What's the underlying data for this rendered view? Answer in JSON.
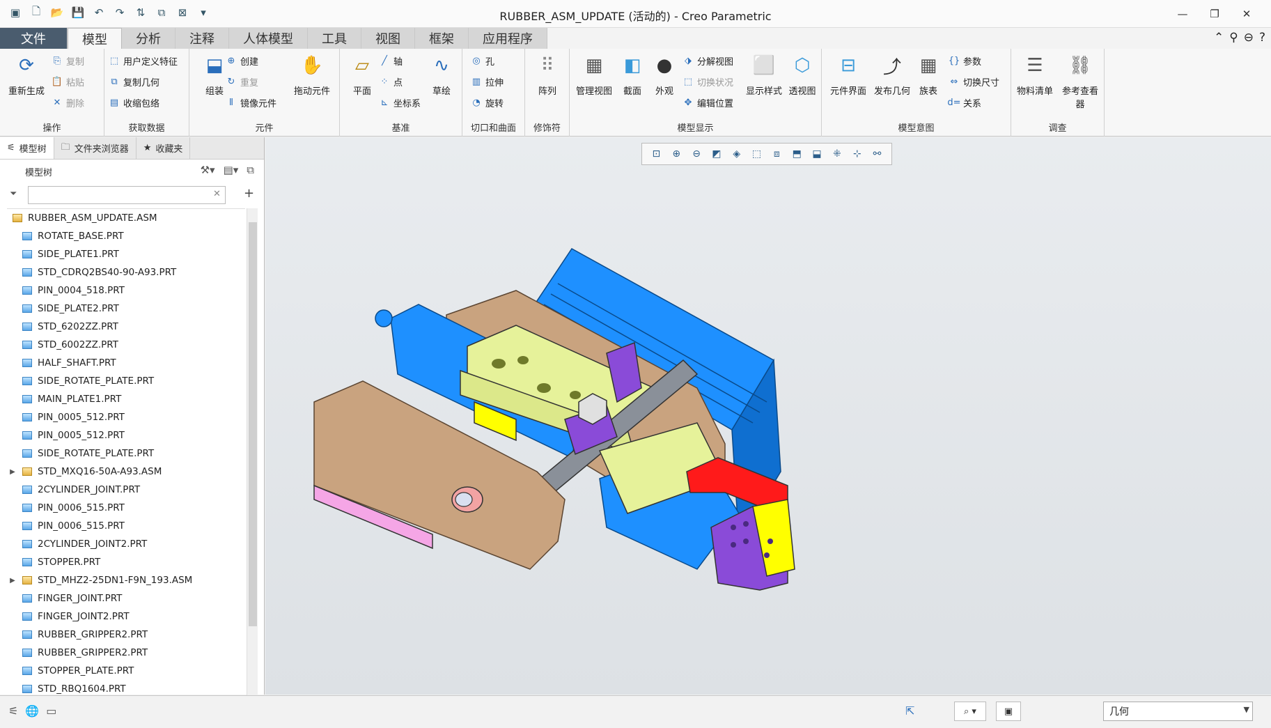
{
  "window": {
    "title": "RUBBER_ASM_UPDATE (活动的) - Creo Parametric",
    "controls": [
      "—",
      "❐",
      "✕"
    ]
  },
  "ribbon_tabs": [
    "文件",
    "模型",
    "分析",
    "注释",
    "人体模型",
    "工具",
    "视图",
    "框架",
    "应用程序"
  ],
  "ribbon": {
    "operations": {
      "label": "操作",
      "regenerate": "重新生成",
      "copy": "复制",
      "paste": "粘贴",
      "delete": "删除"
    },
    "get_data": {
      "label": "获取数据",
      "udf": "用户定义特征",
      "copy_geom": "复制几何",
      "shrinkwrap": "收缩包络"
    },
    "component": {
      "label": "元件",
      "assemble": "组装",
      "create": "创建",
      "repeat": "重复",
      "mirror": "镜像元件",
      "drag": "拖动元件"
    },
    "datum": {
      "label": "基准",
      "plane": "平面",
      "axis": "轴",
      "point": "点",
      "csys": "坐标系",
      "sketch": "草绘"
    },
    "cut_surface": {
      "label": "切口和曲面",
      "hole": "孔",
      "extrude": "拉伸",
      "revolve": "旋转"
    },
    "modifiers": {
      "label": "修饰符",
      "pattern": "阵列"
    },
    "model_display": {
      "label": "模型显示",
      "manage_views": "管理视图",
      "section": "截面",
      "appearance": "外观",
      "explode": "分解视图",
      "toggle": "切换状况",
      "edit_pos": "编辑位置",
      "display_style": "显示样式",
      "perspective": "透视图"
    },
    "model_intent": {
      "label": "模型意图",
      "comp_interface": "元件界面",
      "publish_geom": "发布几何",
      "family_table": "族表",
      "params": "参数",
      "switch_dims": "切换尺寸",
      "relations": "关系"
    },
    "investigate": {
      "label": "调查",
      "bom": "物料清单",
      "ref_viewer": "参考查看器"
    }
  },
  "nav_tabs": [
    "模型树",
    "文件夹浏览器",
    "收藏夹"
  ],
  "tree_header": "模型树",
  "tree": [
    {
      "name": "RUBBER_ASM_UPDATE.ASM",
      "type": "asm",
      "root": true
    },
    {
      "name": "ROTATE_BASE.PRT",
      "type": "prt"
    },
    {
      "name": "SIDE_PLATE1.PRT",
      "type": "prt"
    },
    {
      "name": "STD_CDRQ2BS40-90-A93.PRT",
      "type": "prt"
    },
    {
      "name": "PIN_0004_518.PRT",
      "type": "prt"
    },
    {
      "name": "SIDE_PLATE2.PRT",
      "type": "prt"
    },
    {
      "name": "STD_6202ZZ.PRT",
      "type": "prt"
    },
    {
      "name": "STD_6002ZZ.PRT",
      "type": "prt"
    },
    {
      "name": "HALF_SHAFT.PRT",
      "type": "prt"
    },
    {
      "name": "SIDE_ROTATE_PLATE.PRT",
      "type": "prt"
    },
    {
      "name": "MAIN_PLATE1.PRT",
      "type": "prt"
    },
    {
      "name": "PIN_0005_512.PRT",
      "type": "prt"
    },
    {
      "name": "PIN_0005_512.PRT",
      "type": "prt"
    },
    {
      "name": "SIDE_ROTATE_PLATE.PRT",
      "type": "prt"
    },
    {
      "name": "STD_MXQ16-50A-A93.ASM",
      "type": "asm",
      "expandable": true
    },
    {
      "name": "2CYLINDER_JOINT.PRT",
      "type": "prt"
    },
    {
      "name": "PIN_0006_515.PRT",
      "type": "prt"
    },
    {
      "name": "PIN_0006_515.PRT",
      "type": "prt"
    },
    {
      "name": "2CYLINDER_JOINT2.PRT",
      "type": "prt"
    },
    {
      "name": "STOPPER.PRT",
      "type": "prt"
    },
    {
      "name": "STD_MHZ2-25DN1-F9N_193.ASM",
      "type": "asm",
      "expandable": true
    },
    {
      "name": "FINGER_JOINT.PRT",
      "type": "prt"
    },
    {
      "name": "FINGER_JOINT2.PRT",
      "type": "prt"
    },
    {
      "name": "RUBBER_GRIPPER2.PRT",
      "type": "prt"
    },
    {
      "name": "RUBBER_GRIPPER2.PRT",
      "type": "prt"
    },
    {
      "name": "STOPPER_PLATE.PRT",
      "type": "prt"
    },
    {
      "name": "STD_RBQ1604.PRT",
      "type": "prt"
    }
  ],
  "status": {
    "filter_value": "几何"
  },
  "colors": {
    "file_tab": "#4a5c6e",
    "blue": "#1e90ff",
    "tan": "#c9a37f",
    "yellow_green": "#e6f29a",
    "yellow": "#ffff00",
    "purple": "#8a4bd8",
    "red": "#ff1a1a",
    "grey": "#8a9099",
    "pink": "#f5a6e6"
  }
}
